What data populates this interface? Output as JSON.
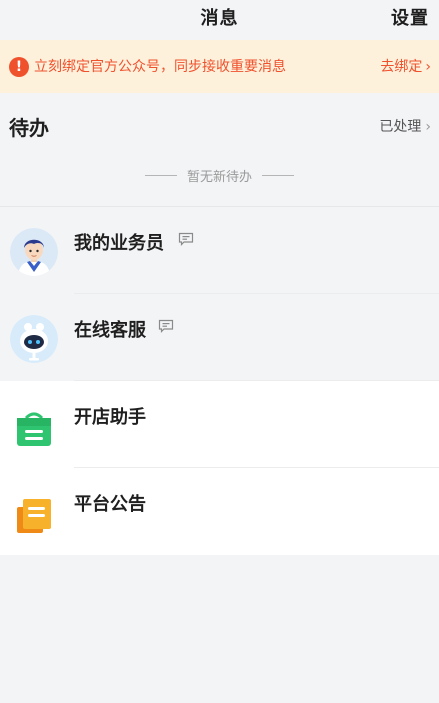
{
  "header": {
    "title": "消息",
    "settings_label": "设置"
  },
  "banner": {
    "warning_icon": "!",
    "message": "立刻绑定官方公众号，同步接收重要消息",
    "action_label": "去绑定",
    "chevron": "›",
    "color": "#f0512d",
    "background": "#fdf1dc"
  },
  "todo": {
    "title": "待办",
    "processed_label": "已处理",
    "chevron": "›",
    "empty_text": "暂无新待办"
  },
  "messages": [
    {
      "label": "我的业务员",
      "icon": "salesperson-avatar",
      "has_chat_icon": true
    },
    {
      "label": "在线客服",
      "icon": "robot-avatar",
      "has_chat_icon": true
    },
    {
      "label": "开店助手",
      "icon": "store-bag-icon",
      "has_chat_icon": false,
      "icon_color": "#2fc46f"
    },
    {
      "label": "平台公告",
      "icon": "notice-icon",
      "has_chat_icon": false,
      "icon_color": "#f7a319"
    }
  ]
}
